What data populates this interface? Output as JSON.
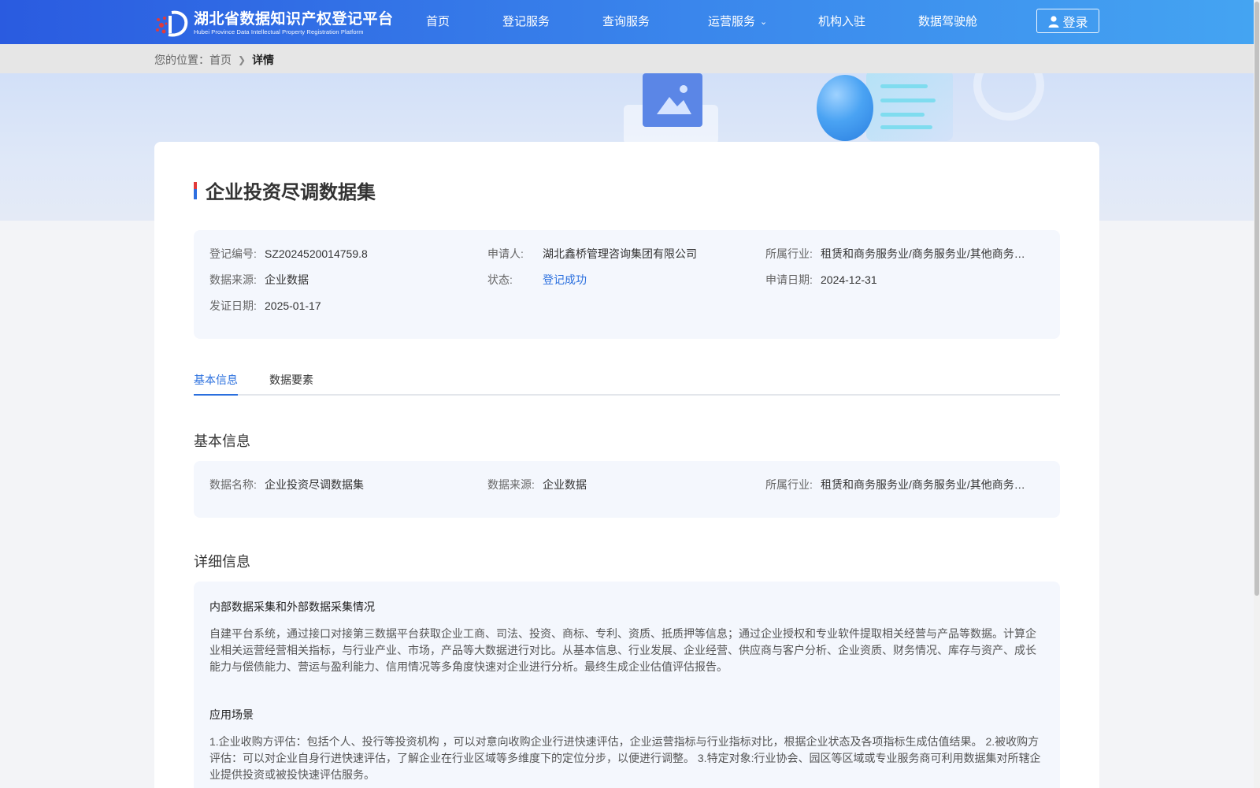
{
  "header": {
    "logo_cn": "湖北省数据知识产权登记平台",
    "logo_en": "Hubei Province Data Intellectual Property Registration Platform",
    "nav": [
      {
        "label": "首页"
      },
      {
        "label": "登记服务"
      },
      {
        "label": "查询服务"
      },
      {
        "label": "运营服务"
      },
      {
        "label": "机构入驻"
      },
      {
        "label": "数据驾驶舱"
      }
    ],
    "login_label": "登录",
    "colors": {
      "start": "#2a5be0",
      "end": "#44a4f2"
    }
  },
  "breadcrumb": {
    "prefix": "您的位置：",
    "home": "首页",
    "current": "详情"
  },
  "detail": {
    "title": "企业投资尽调数据集",
    "summary": {
      "reg_no_label": "登记编号:",
      "reg_no": "SZ2024520014759.8",
      "applicant_label": "申请人:",
      "applicant": "湖北鑫桥管理咨询集团有限公司",
      "industry_label": "所属行业:",
      "industry": "租赁和商务服务业/商务服务业/其他商务…",
      "source_label": "数据来源:",
      "source": "企业数据",
      "status_label": "状态:",
      "status": "登记成功",
      "apply_date_label": "申请日期:",
      "apply_date": "2024-12-31",
      "cert_date_label": "发证日期:",
      "cert_date": "2025-01-17"
    },
    "tabs": [
      {
        "label": "基本信息",
        "active": true
      },
      {
        "label": "数据要素",
        "active": false
      }
    ],
    "basic": {
      "section_title": "基本信息",
      "name_label": "数据名称:",
      "name": "企业投资尽调数据集",
      "source_label": "数据来源:",
      "source": "企业数据",
      "industry_label": "所属行业:",
      "industry": "租赁和商务服务业/商务服务业/其他商务…"
    },
    "more": {
      "section_title": "详细信息",
      "blocks": [
        {
          "heading": "内部数据采集和外部数据采集情况",
          "body": "自建平台系统，通过接口对接第三数据平台获取企业工商、司法、投资、商标、专利、资质、抵质押等信息；通过企业授权和专业软件提取相关经营与产品等数据。计算企业相关运营经营相关指标，与行业产业、市场，产品等大数据进行对比。从基本信息、行业发展、企业经营、供应商与客户分析、企业资质、财务情况、库存与资产、成长能力与偿债能力、营运与盈利能力、信用情况等多角度快速对企业进行分析。最终生成企业估值评估报告。"
        },
        {
          "heading": "应用场景",
          "body": "1.企业收购方评估：包括个人、投行等投资机构 ，可以对意向收购企业行进快速评估，企业运营指标与行业指标对比，根据企业状态及各项指标生成估值结果。 2.被收购方评估：可以对企业自身行进快速评估，了解企业在行业区域等多维度下的定位分步，以便进行调整。 3.特定对象:行业协会、园区等区域或专业服务商可利用数据集对所辖企业提供投资或被投快速评估服务。"
        }
      ]
    },
    "status_color": "#2a6fde"
  }
}
